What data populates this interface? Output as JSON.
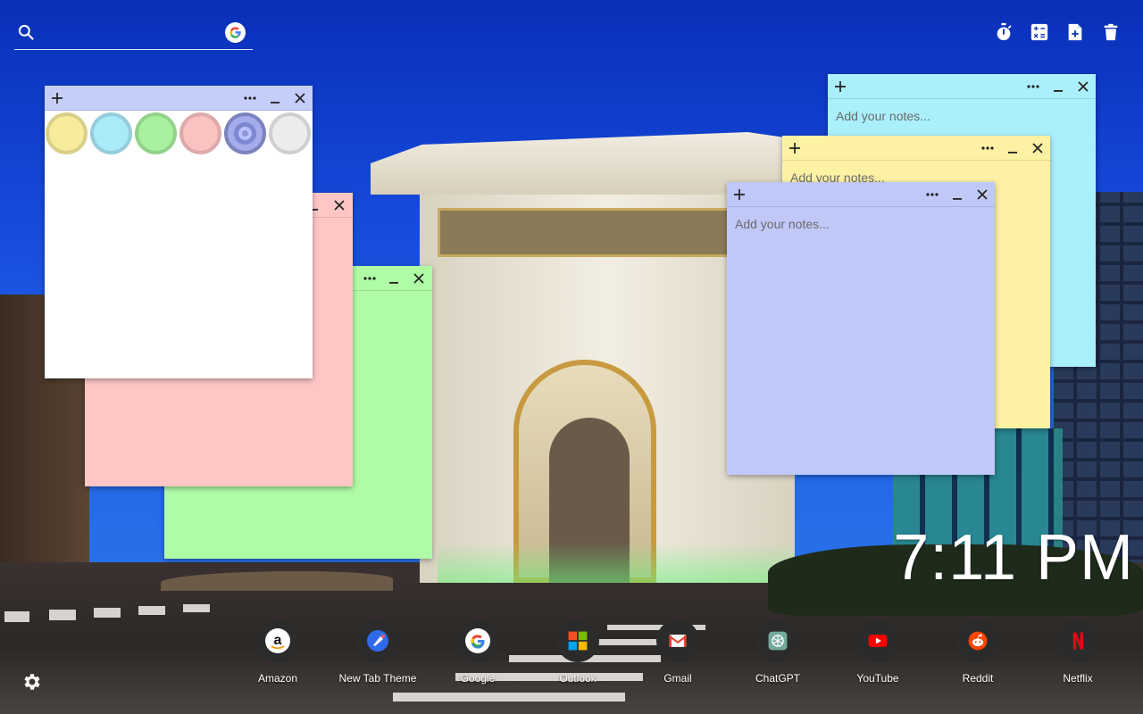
{
  "search": {
    "placeholder": "",
    "value": ""
  },
  "tools": [
    {
      "icon": "stopwatch-icon"
    },
    {
      "icon": "calculator-icon"
    },
    {
      "icon": "new-note-icon"
    },
    {
      "icon": "trash-icon"
    }
  ],
  "notes": {
    "white": {
      "color": "#ffffff",
      "head": "#c5cef9"
    },
    "pink": {
      "color": "#ffc6c6"
    },
    "green": {
      "color": "#b0fba6"
    },
    "cyan": {
      "color": "#aaf0fc",
      "placeholder": "Add your notes..."
    },
    "yellow": {
      "color": "#fdf1a4",
      "placeholder": "Add your notes..."
    },
    "blue": {
      "color": "#c0c8f8",
      "placeholder": "Add your notes..."
    }
  },
  "swatches": [
    "#f7ec9c",
    "#aaebf9",
    "#a9f0a0",
    "#fbc2c2",
    "#8c96d8",
    "#ececec"
  ],
  "clock": {
    "time": "7:11 PM"
  },
  "shortcuts": [
    {
      "label": "Amazon",
      "icon": "amazon-icon"
    },
    {
      "label": "New Tab Theme",
      "icon": "new-tab-theme-icon"
    },
    {
      "label": "Google",
      "icon": "google-icon"
    },
    {
      "label": "Outlook",
      "icon": "outlook-icon"
    },
    {
      "label": "Gmail",
      "icon": "gmail-icon"
    },
    {
      "label": "ChatGPT",
      "icon": "chatgpt-icon"
    },
    {
      "label": "YouTube",
      "icon": "youtube-icon"
    },
    {
      "label": "Reddit",
      "icon": "reddit-icon"
    },
    {
      "label": "Netflix",
      "icon": "netflix-icon"
    }
  ]
}
